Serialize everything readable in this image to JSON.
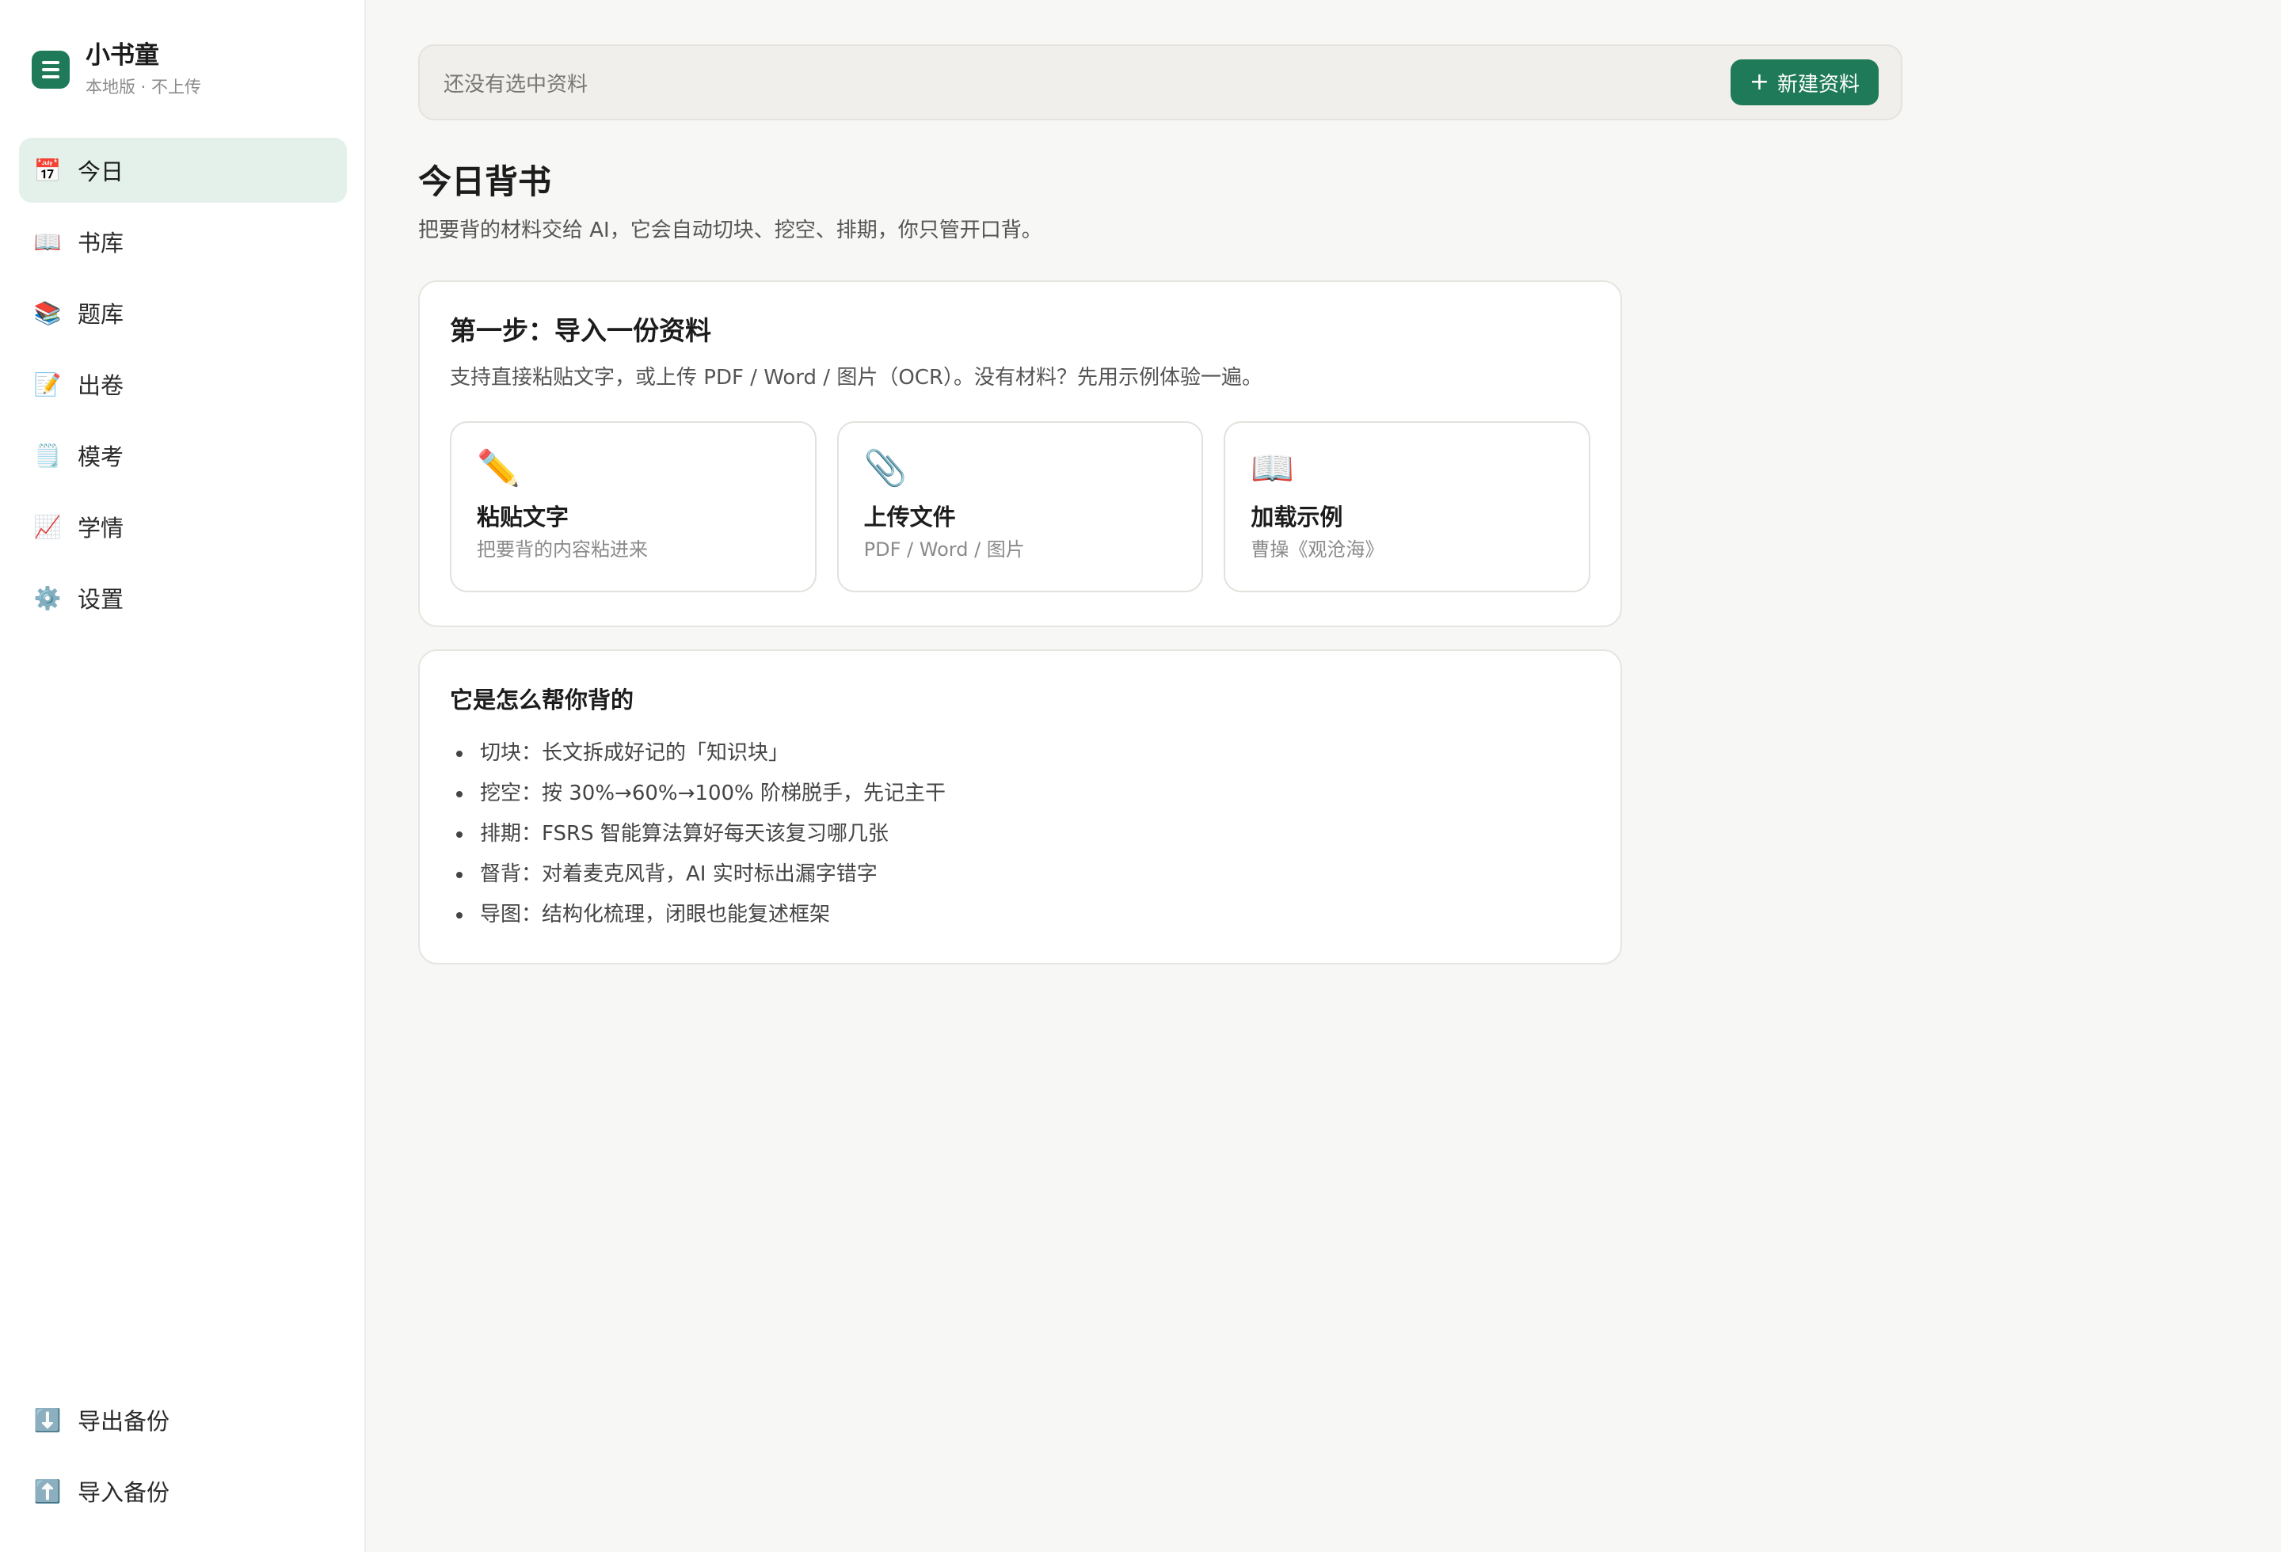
{
  "app": {
    "name": "小书童",
    "subtitle": "本地版 · 不上传"
  },
  "nav": [
    {
      "icon": "calendar-icon",
      "glyph": "📅",
      "label": "今日",
      "active": true
    },
    {
      "icon": "book-icon",
      "glyph": "📖",
      "label": "书库",
      "active": false
    },
    {
      "icon": "books-icon",
      "glyph": "📚",
      "label": "题库",
      "active": false
    },
    {
      "icon": "memo-icon",
      "glyph": "📝",
      "label": "出卷",
      "active": false
    },
    {
      "icon": "notepad-icon",
      "glyph": "🗒️",
      "label": "模考",
      "active": false
    },
    {
      "icon": "chart-up-icon",
      "glyph": "📈",
      "label": "学情",
      "active": false
    },
    {
      "icon": "gear-icon",
      "glyph": "⚙️",
      "label": "设置",
      "active": false
    }
  ],
  "nav_bottom": [
    {
      "icon": "download-icon",
      "glyph": "⬇️",
      "label": "导出备份"
    },
    {
      "icon": "upload-icon",
      "glyph": "⬆️",
      "label": "导入备份"
    }
  ],
  "topbar": {
    "status": "还没有选中资料",
    "new_button": "新建资料",
    "new_button_plus": "+"
  },
  "page": {
    "title": "今日背书",
    "description": "把要背的材料交给 AI，它会自动切块、挖空、排期，你只管开口背。"
  },
  "step_card": {
    "title": "第一步：导入一份资料",
    "description": "支持直接粘贴文字，或上传 PDF / Word / 图片（OCR）。没有材料？先用示例体验一遍。",
    "options": [
      {
        "icon": "pencil-icon",
        "glyph": "✏️",
        "title": "粘贴文字",
        "subtitle": "把要背的内容粘进来"
      },
      {
        "icon": "paperclip-icon",
        "glyph": "📎",
        "title": "上传文件",
        "subtitle": "PDF / Word / 图片"
      },
      {
        "icon": "open-book-icon",
        "glyph": "📖",
        "title": "加载示例",
        "subtitle": "曹操《观沧海》"
      }
    ]
  },
  "how_card": {
    "title": "它是怎么帮你背的",
    "items": [
      "切块：长文拆成好记的「知识块」",
      "挖空：按 30%→60%→100% 阶梯脱手，先记主干",
      "排期：FSRS 智能算法算好每天该复习哪几张",
      "督背：对着麦克风背，AI 实时标出漏字错字",
      "导图：结构化梳理，闭眼也能复述框架"
    ]
  },
  "colors": {
    "accent": "#1f7a5a",
    "active_nav_bg": "#e3f1ea",
    "page_bg": "#f7f7f5"
  }
}
